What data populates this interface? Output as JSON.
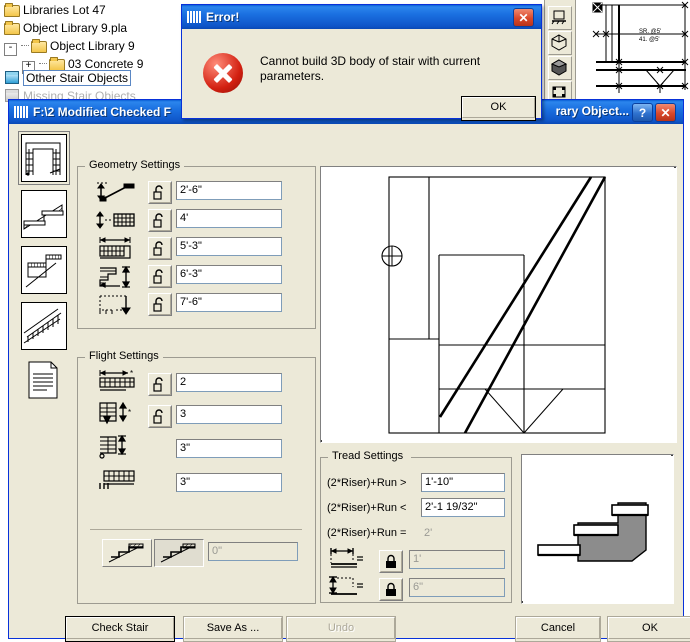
{
  "background": {
    "tree": {
      "items": [
        {
          "label": "Libraries Lot 47",
          "icon": "folder-icon",
          "indent": 0,
          "expander": "",
          "state": "normal"
        },
        {
          "label": "Object Library 9.pla",
          "icon": "folder-icon",
          "indent": 0,
          "expander": "",
          "state": "normal"
        },
        {
          "label": "Object Library 9",
          "icon": "folder-icon",
          "indent": 1,
          "expander": "-",
          "state": "normal"
        },
        {
          "label": "03 Concrete 9",
          "icon": "folder-icon",
          "indent": 2,
          "expander": "+",
          "state": "normal"
        },
        {
          "label": "Other Stair Objects",
          "icon": "library-part-icon",
          "indent": 0,
          "expander": "",
          "state": "selected"
        },
        {
          "label": "Missing Stair Objects",
          "icon": "library-part-icon-disabled",
          "indent": 0,
          "expander": "",
          "state": "disabled"
        }
      ]
    },
    "cad": {
      "dimension_labels": [
        "SR. @5'",
        "41. @5'"
      ],
      "toolbar_icons": [
        "elevation-icon",
        "axonometric-icon",
        "3d-view-icon",
        "animation-icon"
      ]
    }
  },
  "error_dialog": {
    "title": "Error!",
    "title_icon": "library-object-icon",
    "message": "Cannot build 3D body of stair with current parameters.",
    "icon": "error-cross-icon",
    "ok_label": "OK",
    "close_label": "✕",
    "accent_color": "#0a5fd4",
    "error_color": "#d21f10"
  },
  "main_dialog": {
    "title": "F:\\2 Modified Checked F",
    "title_right": "rary Object...",
    "title_icon": "library-object-icon",
    "help_label": "?",
    "close_label": "✕",
    "tabs": [
      {
        "name": "plan-symbol-tab",
        "icon": "stair-plan-icon",
        "selected": true
      },
      {
        "name": "structure-tab",
        "icon": "stair-section-icon",
        "selected": false
      },
      {
        "name": "stringer-tab",
        "icon": "stair-stringer-icon",
        "selected": false
      },
      {
        "name": "railing-tab",
        "icon": "stair-railing-icon",
        "selected": false
      },
      {
        "name": "listing-tab",
        "icon": "document-icon",
        "selected": false
      }
    ],
    "geometry_settings": {
      "legend": "Geometry Settings",
      "rows": [
        {
          "icon": "stair-total-rise-icon",
          "lock": "unlocked",
          "value": "2'-6\"",
          "disabled": false
        },
        {
          "icon": "stair-riser-height-icon",
          "lock": "unlocked",
          "value": "4'",
          "disabled": false
        },
        {
          "icon": "stair-total-run-icon",
          "lock": "unlocked",
          "value": "5'-3\"",
          "disabled": false
        },
        {
          "icon": "stair-headroom-icon",
          "lock": "unlocked",
          "value": "6'-3\"",
          "disabled": false
        },
        {
          "icon": "stair-footprint-icon",
          "lock": "unlocked",
          "value": "7'-6\"",
          "disabled": false
        }
      ]
    },
    "flight_settings": {
      "legend": "Flight Settings",
      "rows": [
        {
          "icon": "flight-count-icon",
          "lock": "unlocked",
          "value": "2",
          "disabled": false
        },
        {
          "icon": "flight-risers-icon",
          "lock": "unlocked",
          "value": "3",
          "disabled": false
        },
        {
          "icon": "flight-rise-icon",
          "lock": "none",
          "value": "3\"",
          "disabled": false
        },
        {
          "icon": "flight-landing-icon",
          "lock": "none",
          "value": "3\"",
          "disabled": false
        }
      ],
      "toggles": [
        {
          "name": "stair-start-profile-toggle",
          "icon": "stair-profile-a-icon",
          "selected": false
        },
        {
          "name": "stair-end-profile-toggle",
          "icon": "stair-profile-b-icon",
          "selected": true
        }
      ],
      "toggle_value": "0\"",
      "toggle_value_disabled": true
    },
    "tread_settings": {
      "legend": "Tread Settings",
      "rules": [
        {
          "label": "(2*Riser)+Run >",
          "value": "1'-10\"",
          "readonly": false
        },
        {
          "label": "(2*Riser)+Run <",
          "value": "2'-1 19/32\"",
          "readonly": false
        },
        {
          "label": "(2*Riser)+Run =",
          "value": "2'",
          "readonly": true
        }
      ],
      "rows": [
        {
          "icon": "tread-run-icon",
          "lock": "locked",
          "value": "1'",
          "disabled": true
        },
        {
          "icon": "tread-rise-icon",
          "lock": "locked",
          "value": "6\"",
          "disabled": true
        }
      ]
    },
    "previews": {
      "plan_preview_name": "stair-plan-preview",
      "tread_preview_name": "tread-profile-preview"
    },
    "buttons": [
      {
        "name": "check-stair-button",
        "label": "Check Stair",
        "disabled": false,
        "default": true
      },
      {
        "name": "save-as-button",
        "label": "Save As ...",
        "disabled": false,
        "default": false
      },
      {
        "name": "undo-button",
        "label": "Undo",
        "disabled": true,
        "default": false
      },
      {
        "name": "cancel-button",
        "label": "Cancel",
        "disabled": false,
        "default": false
      },
      {
        "name": "ok-button",
        "label": "OK",
        "disabled": false,
        "default": false
      }
    ]
  }
}
